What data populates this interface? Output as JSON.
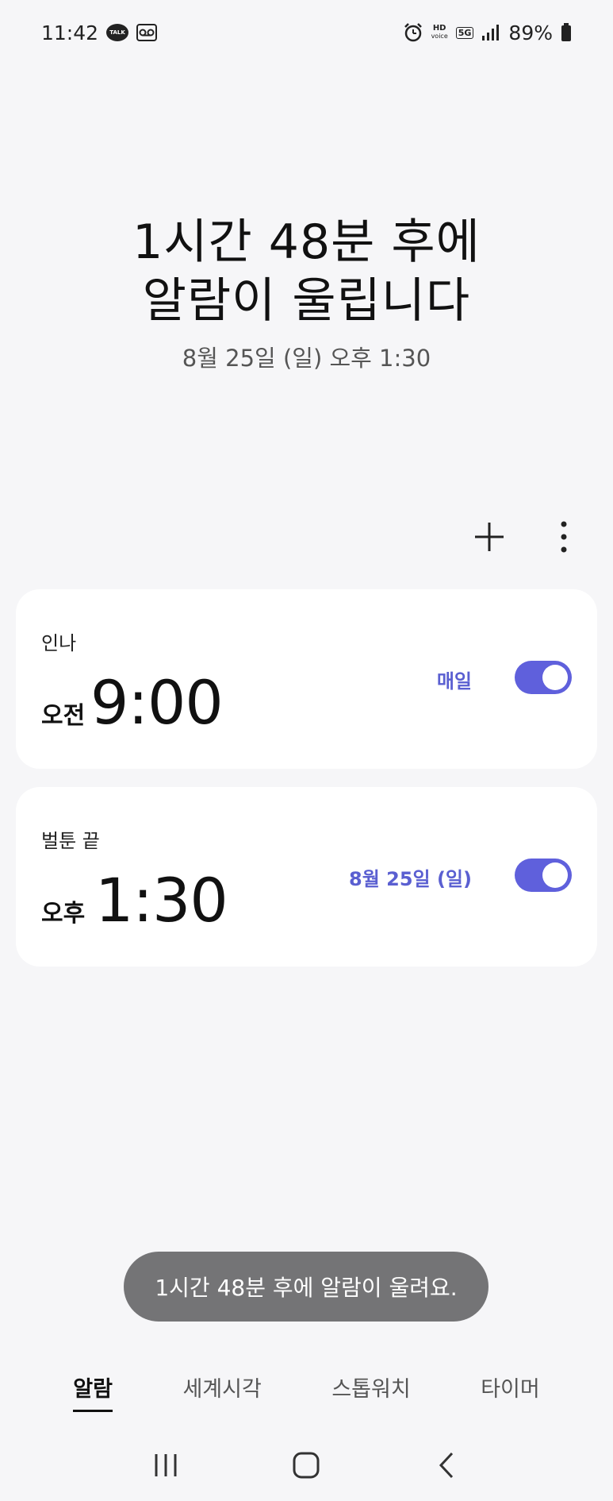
{
  "status_bar": {
    "time": "11:42",
    "talk_label": "TALK",
    "hd_label": "HD",
    "voice_label": "voice",
    "network_label": "5G",
    "battery_percent": "89%"
  },
  "hero": {
    "line1": "1시간 48분 후에",
    "line2": "알람이 울립니다",
    "subtitle": "8월 25일 (일) 오후 1:30"
  },
  "alarms": [
    {
      "name": "인나",
      "ampm": "오전",
      "time": "9:00",
      "repeat": "매일",
      "enabled": true
    },
    {
      "name": "벌툰 끝",
      "ampm": "오후",
      "time": "1:30",
      "repeat": "8월 25일 (일)",
      "enabled": true
    }
  ],
  "toast": {
    "message": "1시간 48분 후에 알람이 울려요."
  },
  "tabs": [
    {
      "label": "알람",
      "active": true
    },
    {
      "label": "세계시각",
      "active": false
    },
    {
      "label": "스톱워치",
      "active": false
    },
    {
      "label": "타이머",
      "active": false
    }
  ],
  "colors": {
    "accent": "#5f60dc",
    "repeat_text": "#5a5fd1",
    "background": "#f6f6f8"
  },
  "icons": {
    "add": "plus-icon",
    "more": "more-vertical-icon",
    "nav_recent": "recent-apps-icon",
    "nav_home": "home-icon",
    "nav_back": "back-icon"
  }
}
